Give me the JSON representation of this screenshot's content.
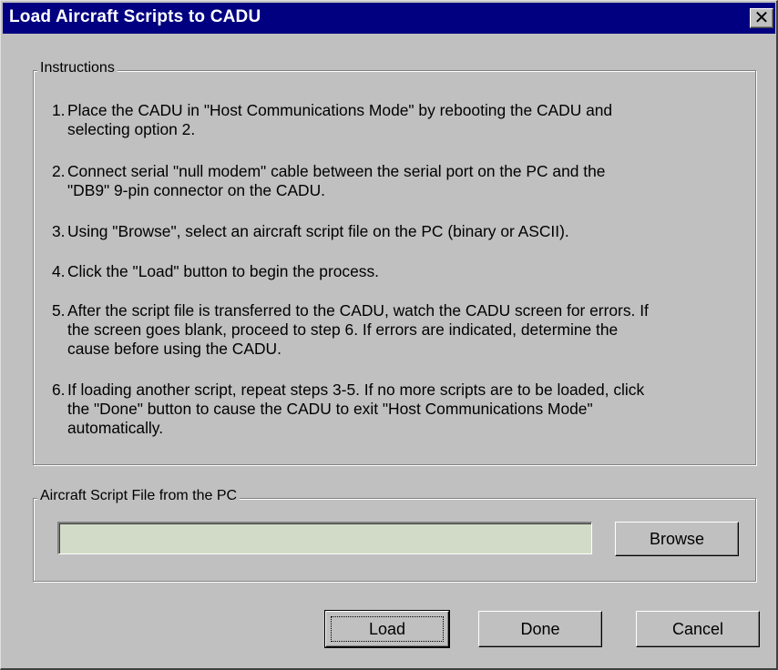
{
  "window": {
    "title": "Load Aircraft Scripts to CADU",
    "close_glyph": "✕",
    "close_icon": "close-icon"
  },
  "instructions": {
    "legend": "Instructions",
    "steps": [
      {
        "num": "1.",
        "lines": [
          "Place the CADU in \"Host Communications Mode\" by rebooting the CADU and",
          "selecting option 2."
        ]
      },
      {
        "num": "2.",
        "lines": [
          "Connect serial \"null modem\" cable between the serial port on the PC and the",
          "\"DB9\" 9-pin connector on the CADU."
        ]
      },
      {
        "num": "3.",
        "lines": [
          "Using \"Browse\", select an aircraft script file on the PC (binary or ASCII)."
        ]
      },
      {
        "num": "4.",
        "lines": [
          "Click the \"Load\" button to begin the process."
        ]
      },
      {
        "num": "5.",
        "lines": [
          "After the script file is transferred to the CADU, watch the CADU screen for errors. If",
          "the screen goes blank, proceed to step 6. If errors are indicated, determine the",
          "cause before using the CADU."
        ]
      },
      {
        "num": "6.",
        "lines": [
          "If loading another script, repeat steps 3-5. If no more scripts are to be loaded, click",
          "the \"Done\" button to cause the CADU to exit \"Host Communications Mode\"",
          "automatically."
        ]
      }
    ]
  },
  "file_section": {
    "legend": "Aircraft Script File from the PC",
    "file_path_value": "",
    "browse_label": "Browse"
  },
  "buttons": {
    "load_label": "Load",
    "done_label": "Done",
    "cancel_label": "Cancel"
  },
  "colors": {
    "titlebar": "#000080",
    "dialog_face": "#c0c0c0",
    "input_background": "#d2dbc8"
  }
}
